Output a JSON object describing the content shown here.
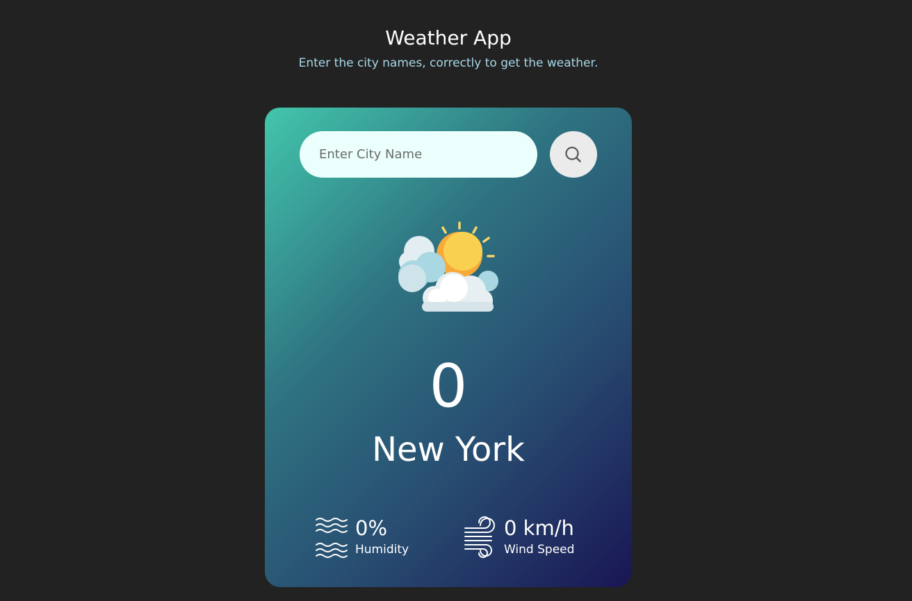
{
  "header": {
    "title": "Weather App",
    "subtitle": "Enter the city names, correctly to get the weather."
  },
  "search": {
    "placeholder": "Enter City Name",
    "value": "",
    "button_icon": "search-icon"
  },
  "weather": {
    "icon": "partly-cloudy-icon",
    "temperature": "0",
    "city": "New York"
  },
  "stats": {
    "humidity": {
      "icon": "humidity-waves-icon",
      "value": "0%",
      "label": "Humidity"
    },
    "wind": {
      "icon": "wind-icon",
      "value": "0 km/h",
      "label": "Wind Speed"
    }
  },
  "colors": {
    "background": "#222222",
    "card_gradient_start": "#43c6ac",
    "card_gradient_end": "#191654",
    "input_bg": "#ebfffc",
    "subtitle": "#a7d8e8",
    "sun": "#f7b733"
  }
}
